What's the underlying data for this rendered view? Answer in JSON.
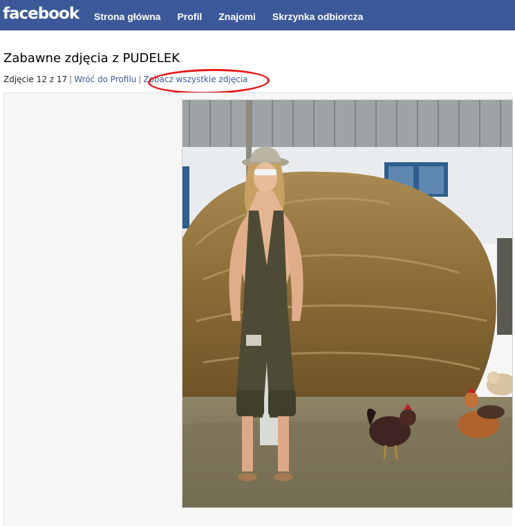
{
  "header": {
    "logo": "facebook",
    "nav": [
      {
        "label": "Strona główna"
      },
      {
        "label": "Profil"
      },
      {
        "label": "Znajomi"
      },
      {
        "label": "Skrzynka odbiorcza"
      }
    ]
  },
  "album": {
    "title": "Zabawne zdjęcia z PUDELEK",
    "counter": "Zdjęcie 12 z 17",
    "back_link": "Wróć do Profilu",
    "all_photos_link": "Zobacz wszystkie zdjęcia"
  },
  "colors": {
    "brand": "#3b5998",
    "link": "#3b5998",
    "annotation": "#e81818"
  }
}
